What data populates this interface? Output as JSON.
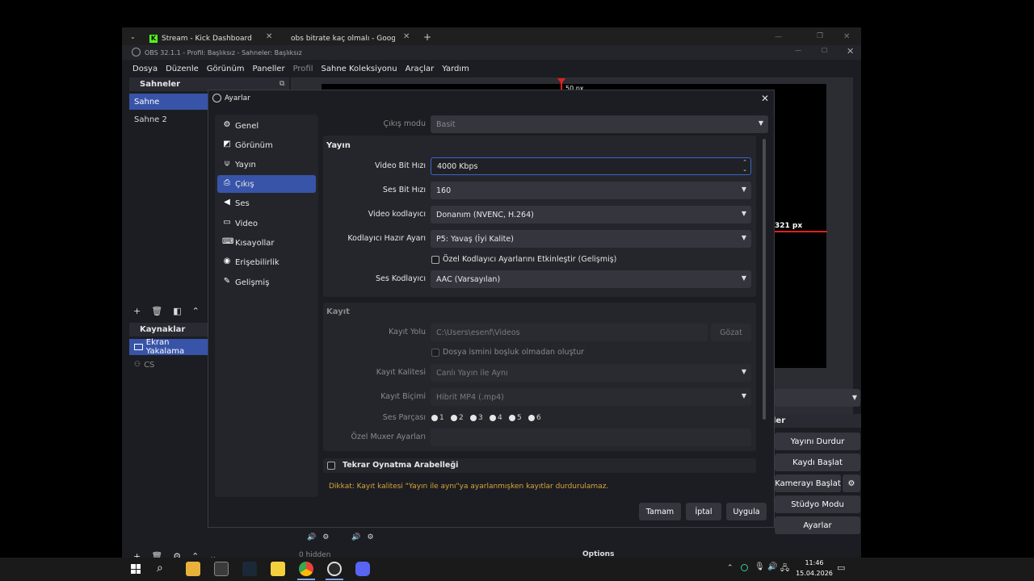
{
  "browser": {
    "tabs": [
      {
        "label": "Stream - Kick Dashboard"
      },
      {
        "label": "obs bitrate kaç olmalı - Google"
      }
    ],
    "new_tab": "+"
  },
  "obs": {
    "title": "OBS 32.1.1 - Profil: Başlıksız - Sahneler: Başlıksız",
    "menu": [
      "Dosya",
      "Düzenle",
      "Görünüm",
      "Paneller",
      "Profil",
      "Sahne Koleksiyonu",
      "Araçlar",
      "Yardım"
    ],
    "scenes": {
      "title": "Sahneler",
      "items": [
        "Sahne",
        "Sahne 2"
      ]
    },
    "sources": {
      "title": "Kaynaklar",
      "items": [
        "Ekran Yakalama",
        "CS"
      ]
    },
    "preview": {
      "width_label": "50 px",
      "height_label": "321 px"
    },
    "controls": {
      "title": "ler",
      "buttons": [
        "Yayını Durdur",
        "Kaydı Başlat",
        "Kamerayı Başlat",
        "Stüdyo Modu",
        "Ayarlar"
      ]
    },
    "mixer": {
      "hidden": "0 hidden",
      "options": "Options"
    }
  },
  "dialog": {
    "title": "Ayarlar",
    "nav": [
      "Genel",
      "Görünüm",
      "Yayın",
      "Çıkış",
      "Ses",
      "Video",
      "Kısayollar",
      "Erişebilirlik",
      "Gelişmiş"
    ],
    "output_mode": {
      "label": "Çıkış modu",
      "value": "Basit"
    },
    "stream": {
      "title": "Yayın",
      "video_bitrate": {
        "label": "Video Bit Hızı",
        "value": "4000 Kbps"
      },
      "audio_bitrate": {
        "label": "Ses Bit Hızı",
        "value": "160"
      },
      "video_encoder": {
        "label": "Video kodlayıcı",
        "value": "Donanım (NVENC, H.264)"
      },
      "encoder_preset": {
        "label": "Kodlayıcı Hazır Ayarı",
        "value": "P5: Yavaş (İyi Kalite)"
      },
      "custom_encoder": {
        "label": "Özel Kodlayıcı Ayarlarını Etkinleştir (Gelişmiş)",
        "checked": false
      },
      "audio_encoder": {
        "label": "Ses Kodlayıcı",
        "value": "AAC (Varsayılan)"
      }
    },
    "recording": {
      "title": "Kayıt",
      "path": {
        "label": "Kayıt Yolu",
        "value": "C:\\Users\\esenf\\Videos",
        "browse": "Gözat"
      },
      "no_space": {
        "label": "Dosya ismini boşluk olmadan oluştur",
        "checked": false
      },
      "quality": {
        "label": "Kayıt Kalitesi",
        "value": "Canlı Yayın ile Aynı"
      },
      "format": {
        "label": "Kayıt Biçimi",
        "value": "Hibrit MP4 (.mp4)"
      },
      "audio_track": {
        "label": "Ses Parçası",
        "tracks": [
          "1",
          "2",
          "3",
          "4",
          "5",
          "6"
        ]
      },
      "muxer": {
        "label": "Özel Muxer Ayarları",
        "value": ""
      }
    },
    "replay": {
      "label": "Tekrar Oynatma Arabelleği",
      "checked": false
    },
    "warning": "Dikkat: Kayıt kalitesi \"Yayın ile aynı\"ya ayarlanmışken kayıtlar durdurulamaz.",
    "buttons": {
      "ok": "Tamam",
      "cancel": "İptal",
      "apply": "Uygula"
    }
  },
  "taskbar": {
    "time": "11:46",
    "date": "15.04.2026"
  },
  "colors": {
    "accent": "#3854a8",
    "warning": "#d6a53a",
    "kick_green": "#53fc18"
  }
}
